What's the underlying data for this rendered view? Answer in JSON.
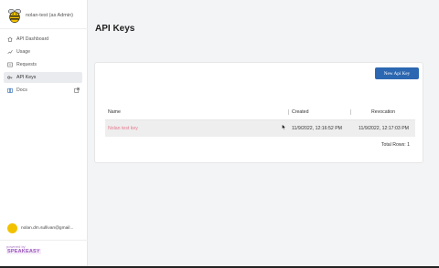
{
  "sidebar": {
    "brand_text": "nolan-test (as Admin)",
    "items": [
      {
        "label": "API Dashboard",
        "icon": "home-icon"
      },
      {
        "label": "Usage",
        "icon": "usage-icon"
      },
      {
        "label": "Requests",
        "icon": "requests-icon"
      },
      {
        "label": "API Keys",
        "icon": "key-icon"
      },
      {
        "label": "Docs",
        "icon": "docs-icon"
      }
    ],
    "active_item": "API Keys",
    "user_email": "nolan.dm.sullivan@gmail...",
    "badge_small": "powered by",
    "badge_main": "SPEAKEASY"
  },
  "main": {
    "title": "API Keys",
    "new_key_button": "New Api Key",
    "table": {
      "columns": [
        "Name",
        "Created",
        "Revocation"
      ],
      "rows": [
        {
          "name": "Nolan test key",
          "created": "11/9/2022, 12:16:52 PM",
          "revocation": "11/9/2022, 12:17:03 PM"
        }
      ],
      "total_rows_label": "Total Rows: 1"
    }
  },
  "colors": {
    "primary_button": "#2c67b1",
    "key_name": "#e67a90",
    "avatar": "#f2c200",
    "badge": "#9a57b9"
  }
}
